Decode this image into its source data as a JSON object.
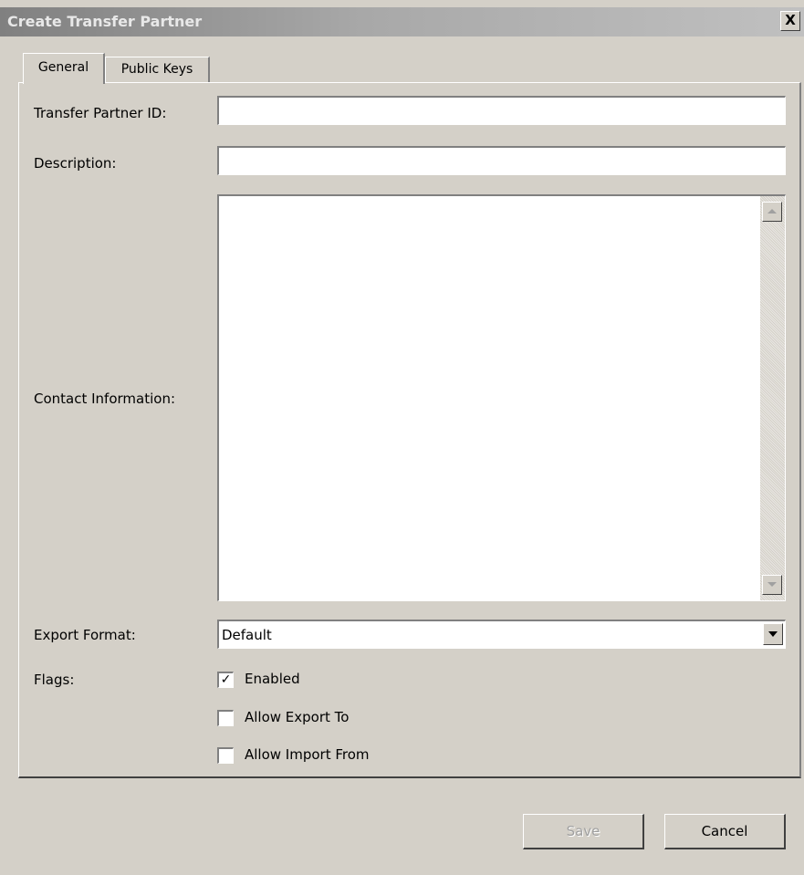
{
  "window": {
    "title": "Create Transfer Partner",
    "close_glyph": "X"
  },
  "tabs": [
    {
      "label": "General",
      "active": true
    },
    {
      "label": "Public Keys",
      "active": false
    }
  ],
  "form": {
    "partner_id_label": "Transfer Partner ID:",
    "partner_id_value": "",
    "description_label": "Description:",
    "description_value": "",
    "contact_label": "Contact Information:",
    "contact_value": "",
    "export_format_label": "Export Format:",
    "export_format_value": "Default",
    "flags_label": "Flags:",
    "flags": [
      {
        "label": "Enabled",
        "checked": true
      },
      {
        "label": "Allow Export To",
        "checked": false
      },
      {
        "label": "Allow Import From",
        "checked": false
      }
    ]
  },
  "buttons": {
    "save_label": "Save",
    "save_enabled": false,
    "cancel_label": "Cancel"
  },
  "icons": {
    "close": "close-icon",
    "scroll_up": "scroll-up-arrow-icon",
    "scroll_down": "scroll-down-arrow-icon",
    "dropdown": "chevron-down-icon",
    "check": "checkmark-icon"
  }
}
